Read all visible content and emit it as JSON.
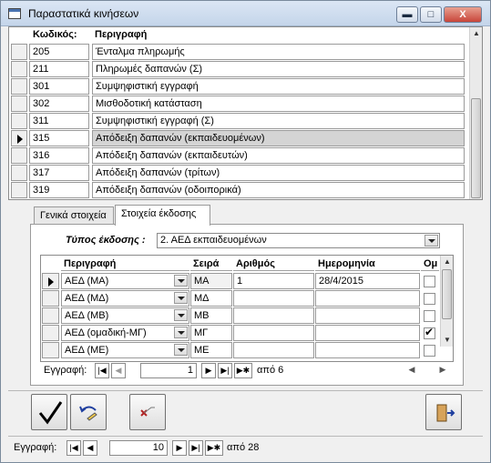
{
  "window": {
    "title": "Παραστατικά κινήσεων",
    "minimize_label": "▬",
    "maximize_label": "□",
    "close_label": "X"
  },
  "list": {
    "columns": {
      "code": "Κωδικός:",
      "description": "Περιγραφή"
    },
    "rows": [
      {
        "code": "205",
        "description": "Ένταλμα πληρωμής"
      },
      {
        "code": "211",
        "description": "Πληρωμές δαπανών (Σ)"
      },
      {
        "code": "301",
        "description": "Συμψηφιστική εγγραφή"
      },
      {
        "code": "302",
        "description": "Μισθοδοτική κατάσταση"
      },
      {
        "code": "311",
        "description": "Συμψηφιστική εγγραφή (Σ)"
      },
      {
        "code": "315",
        "description": "Απόδειξη δαπανών (εκπαιδευομένων)"
      },
      {
        "code": "316",
        "description": "Απόδειξη δαπανών (εκπαιδευτών)"
      },
      {
        "code": "317",
        "description": "Απόδειξη δαπανών (τρίτων)"
      },
      {
        "code": "319",
        "description": "Απόδειξη δαπανών (οδοιπορικά)"
      }
    ],
    "current_row": 5
  },
  "tabs": [
    {
      "label": "Γενικά στοιχεία",
      "active": false
    },
    {
      "label": "Στοιχεία έκδοσης",
      "active": true
    }
  ],
  "issue": {
    "type_label": "Τύπος έκδοσης :",
    "type_value": "2. ΑΕΔ εκπαιδευομένων"
  },
  "subform": {
    "columns": {
      "description": "Περιγραφή",
      "series": "Σειρά",
      "number": "Αριθμός",
      "date": "Ημερομηνία",
      "flag": "Ομ"
    },
    "rows": [
      {
        "description": "ΑΕΔ (ΜΑ)",
        "series": "ΜΑ",
        "number": "1",
        "date": "28/4/2015",
        "checked": false
      },
      {
        "description": "ΑΕΔ (ΜΔ)",
        "series": "ΜΔ",
        "number": "",
        "date": "",
        "checked": false
      },
      {
        "description": "ΑΕΔ (ΜΒ)",
        "series": "ΜΒ",
        "number": "",
        "date": "",
        "checked": false
      },
      {
        "description": "ΑΕΔ (ομαδική-ΜΓ)",
        "series": "ΜΓ",
        "number": "",
        "date": "",
        "checked": true
      },
      {
        "description": "ΑΕΔ (ΜΕ)",
        "series": "ΜΕ",
        "number": "",
        "date": "",
        "checked": false
      }
    ],
    "nav": {
      "label": "Εγγραφή:",
      "current": "1",
      "of_text": "από 6"
    }
  },
  "toolbar": {
    "save_icon": "checkmark-icon",
    "undo_icon": "undo-icon",
    "delete_icon": "delete-x-icon",
    "exit_icon": "exit-door-icon"
  },
  "main_nav": {
    "label": "Εγγραφή:",
    "current": "10",
    "of_text": "από 28"
  },
  "colors": {
    "titlebar": "#c4d5ea",
    "selected_row": "#d4d4d4",
    "window_bg": "#f0f0f0",
    "delete_red": "#b22222"
  }
}
